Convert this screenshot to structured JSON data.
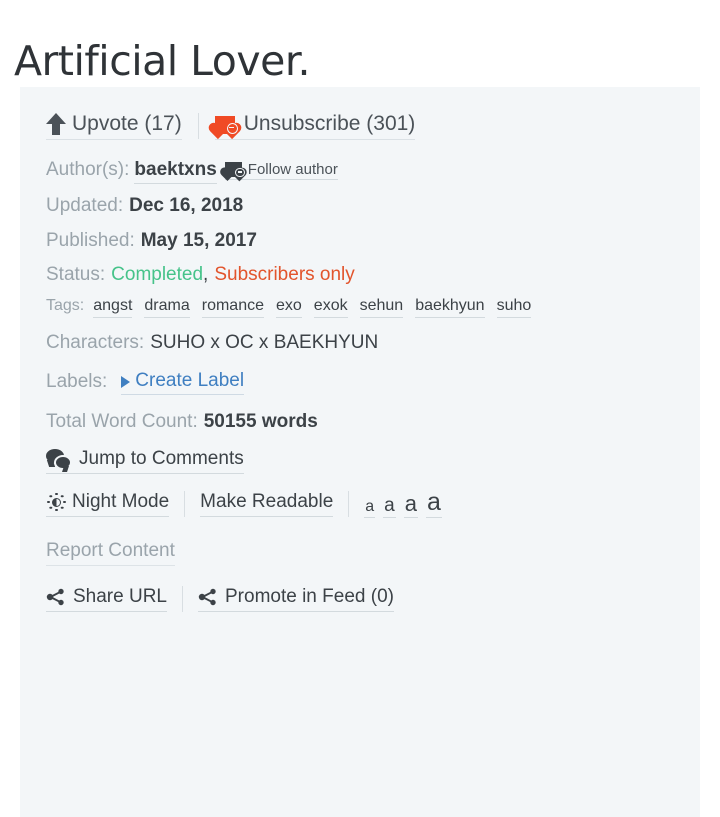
{
  "story": {
    "title": "Artificial Lover."
  },
  "actions": {
    "upvote_label": "Upvote (17)",
    "upvote_icon": "arrow-up-icon",
    "unsubscribe_label": "Unsubscribe (301)",
    "unsubscribe_icon": "heart-minus-icon"
  },
  "meta": {
    "author_label": "Author(s):",
    "author_name": "baektxns",
    "follow_author_label": "Follow author",
    "follow_author_icon": "heart-plus-icon",
    "updated_label": "Updated:",
    "updated_value": "Dec 16, 2018",
    "published_label": "Published:",
    "published_value": "May 15, 2017",
    "status_label": "Status:",
    "status_completed": "Completed",
    "status_separator": ",",
    "status_access": "Subscribers only",
    "tags_label": "Tags:",
    "tags": [
      "angst",
      "drama",
      "romance",
      "exo",
      "exok",
      "sehun",
      "baekhyun",
      "suho"
    ],
    "characters_label": "Characters:",
    "characters_value": "SUHO x OC x BAEKHYUN",
    "labels_label": "Labels:",
    "create_label": "Create Label",
    "create_label_icon": "caret-right-icon",
    "word_count_label": "Total Word Count:",
    "word_count_value": "50155 words"
  },
  "comments": {
    "jump_label": "Jump to Comments",
    "icon": "comments-icon"
  },
  "display_options": {
    "night_mode_label": "Night Mode",
    "night_mode_icon": "brightness-icon",
    "make_readable_label": "Make Readable",
    "font_sizes": [
      "a",
      "a",
      "a",
      "a"
    ]
  },
  "footer": {
    "report_label": "Report Content",
    "share_url_label": "Share URL",
    "share_url_icon": "share-icon",
    "promote_label": "Promote in Feed (0)",
    "promote_icon": "share-icon"
  },
  "colors": {
    "panel_background": "#f3f6f8",
    "page_background": "#ffffff",
    "text_primary": "#3c4247",
    "text_muted": "#9aa4ab",
    "accent_link": "#3f7fc1",
    "status_completed": "#46c38a",
    "status_subscribers": "#e2542c",
    "heart_unsubscribe": "#f04a25",
    "underline": "#d3dade"
  }
}
